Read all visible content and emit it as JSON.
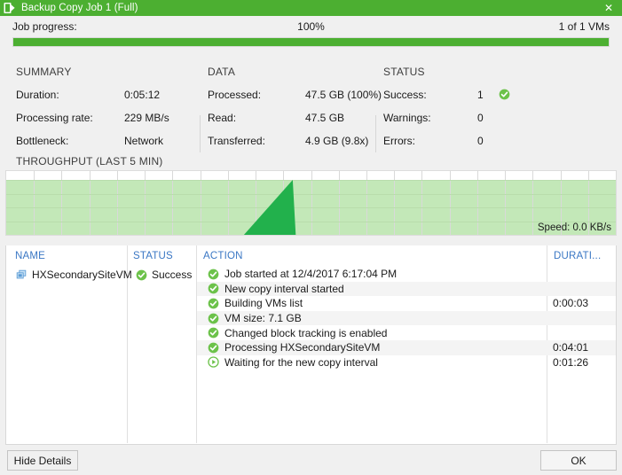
{
  "window": {
    "title": "Backup Copy Job 1 (Full)",
    "title_icon": "backup-job-icon",
    "close_label": "✕",
    "accent_color": "#4caf31"
  },
  "progress": {
    "label": "Job progress:",
    "percent_text": "100%",
    "percent_value": 100,
    "vms_text": "1 of 1 VMs"
  },
  "summary": {
    "heading": "SUMMARY",
    "rows": [
      {
        "key": "Duration:",
        "value": "0:05:12"
      },
      {
        "key": "Processing rate:",
        "value": "229 MB/s"
      },
      {
        "key": "Bottleneck:",
        "value": "Network"
      }
    ]
  },
  "data_panel": {
    "heading": "DATA",
    "rows": [
      {
        "key": "Processed:",
        "value": "47.5 GB (100%)"
      },
      {
        "key": "Read:",
        "value": "47.5 GB"
      },
      {
        "key": "Transferred:",
        "value": "4.9 GB (9.8x)"
      }
    ]
  },
  "status_panel": {
    "heading": "STATUS",
    "rows": [
      {
        "key": "Success:",
        "value": "1",
        "icon": "success-check-icon"
      },
      {
        "key": "Warnings:",
        "value": "0",
        "icon": ""
      },
      {
        "key": "Errors:",
        "value": "0",
        "icon": ""
      }
    ]
  },
  "throughput": {
    "heading": "THROUGHPUT (LAST 5 MIN)",
    "speed_text": "Speed: 0.0 KB/s"
  },
  "chart_data": {
    "type": "area",
    "title": "THROUGHPUT (LAST 5 MIN)",
    "xlabel": "",
    "ylabel": "",
    "grid": true,
    "grid_columns": 22,
    "grid_rows": 4,
    "band_color": "#c3e8b8",
    "series_color": "#22b14c",
    "x": [
      0,
      0.39,
      0.47,
      0.475,
      1.0
    ],
    "values": [
      0,
      0,
      1.0,
      0,
      0
    ],
    "ylim": [
      0,
      1.0
    ],
    "annotation": "Speed: 0.0 KB/s"
  },
  "details": {
    "columns": [
      "NAME",
      "STATUS",
      "ACTION",
      "DURATI..."
    ],
    "vm": {
      "name": "HXSecondarySiteVM",
      "name_icon": "vm-icon",
      "status": "Success",
      "status_icon": "success-check-icon"
    },
    "actions": [
      {
        "icon": "success-check-icon",
        "text": "Job started at 12/4/2017 6:17:04 PM",
        "duration": ""
      },
      {
        "icon": "success-check-icon",
        "text": "New copy interval started",
        "duration": ""
      },
      {
        "icon": "success-check-icon",
        "text": "Building VMs list",
        "duration": "0:00:03"
      },
      {
        "icon": "success-check-icon",
        "text": "VM size: 7.1 GB",
        "duration": ""
      },
      {
        "icon": "success-check-icon",
        "text": "Changed block tracking is enabled",
        "duration": ""
      },
      {
        "icon": "success-check-icon",
        "text": "Processing HXSecondarySiteVM",
        "duration": "0:04:01"
      },
      {
        "icon": "in-progress-play-icon",
        "text": "Waiting for the new copy interval",
        "duration": "0:01:26"
      }
    ]
  },
  "footer": {
    "hide_details_label": "Hide Details",
    "ok_label": "OK"
  }
}
